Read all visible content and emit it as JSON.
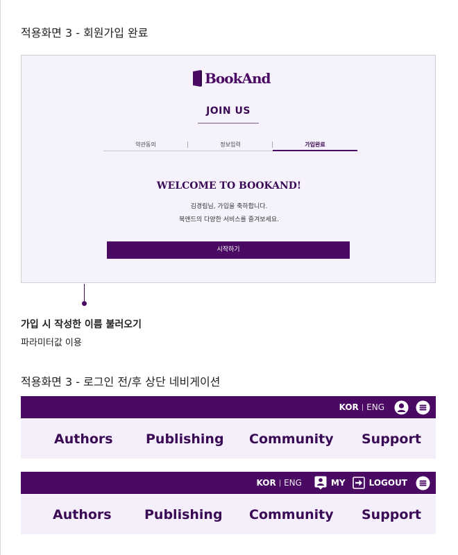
{
  "section1": {
    "title": "적용화면 3 - 회원가입 완료"
  },
  "mock": {
    "logo_text": "BookAnd",
    "join_title": "JOIN US",
    "steps": [
      {
        "label": "약관동의"
      },
      {
        "label": "정보입력"
      },
      {
        "label": "가입완료"
      }
    ],
    "welcome_title": "WELCOME TO BOOKAND!",
    "welcome_line1": "김경림님, 가입을 축하합니다.",
    "welcome_line2": "북앤드의 다양한 서비스를 즐겨보세요.",
    "start_button": "시작하기"
  },
  "callout": {
    "title": "가입 시 작성한 이름 불러오기",
    "desc": "파라미터값 이용"
  },
  "section2": {
    "title": "적용화면 3 - 로그인 전/후 상단 네비게이션"
  },
  "nav_before": {
    "lang_kor": "KOR",
    "lang_sep": "|",
    "lang_eng": "ENG",
    "icons": [
      "user-circle-icon",
      "menu-circle-icon"
    ],
    "menu": [
      "Authors",
      "Publishing",
      "Community",
      "Support"
    ]
  },
  "nav_after": {
    "lang_kor": "KOR",
    "lang_sep": "|",
    "lang_eng": "ENG",
    "my_label": "MY",
    "logout_label": "LOGOUT",
    "icons": [
      "my-profile-icon",
      "logout-icon",
      "menu-circle-icon"
    ],
    "menu": [
      "Authors",
      "Publishing",
      "Community",
      "Support"
    ]
  },
  "colors": {
    "brand": "#4a0a63",
    "gnb_bg": "#f4effb",
    "mock_bg": "#f6f2fc"
  }
}
